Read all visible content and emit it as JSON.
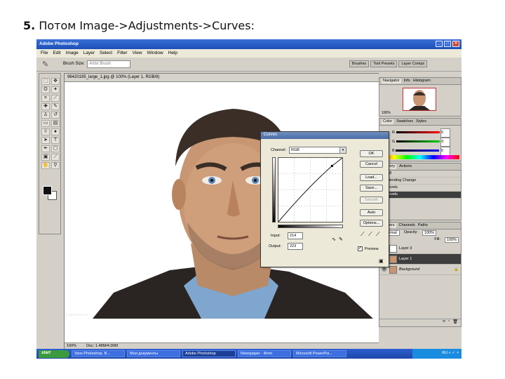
{
  "slide_heading": {
    "number": "5.",
    "text": "Потом Image->Adjustments->Curves:"
  },
  "app": {
    "title": "Adobe Photoshop",
    "menu": [
      "File",
      "Edit",
      "Image",
      "Layer",
      "Select",
      "Filter",
      "View",
      "Window",
      "Help"
    ],
    "options_bar": {
      "label": "Brush Size:",
      "field_placeholder": "Artist Brush",
      "well_tabs": [
        "Brushes",
        "Tool Presets",
        "Layer Comps"
      ]
    },
    "document": {
      "title": "96420195_large_1.jpg @ 100% (Layer 1, RGB/8)",
      "status_zoom": "100%",
      "status_doc": "Doc: 1.48M/4.00M",
      "watermark": "hughlaurie.net"
    },
    "curves_dialog": {
      "title": "Curves",
      "channel_label": "Channel:",
      "channel_value": "RGB",
      "buttons": [
        "OK",
        "Cancel",
        "Load...",
        "Save...",
        "Smooth",
        "Auto",
        "Options..."
      ],
      "disabled_buttons": [
        "Smooth"
      ],
      "input_label": "Input:",
      "input_value": "214",
      "output_label": "Output:",
      "output_value": "223",
      "preview_label": "Preview",
      "preview_checked": true,
      "curve_point": {
        "input": 214,
        "output": 223
      }
    },
    "panels": {
      "navigator_tabs": [
        "Navigator",
        "Info",
        "Histogram"
      ],
      "navigator_zoom": "100%",
      "color_tabs": [
        "Color",
        "Swatches",
        "Styles"
      ],
      "color_channels": [
        {
          "label": "R",
          "value": "0"
        },
        {
          "label": "G",
          "value": "0"
        },
        {
          "label": "B",
          "value": "0"
        }
      ],
      "history_tabs": [
        "History",
        "Actions"
      ],
      "history_items": [
        "Fill",
        "Blending Change",
        "Levels",
        "Levels"
      ],
      "history_selected": 3,
      "layers_tabs": [
        "Layers",
        "Channels",
        "Paths"
      ],
      "layers_mode": "Normal",
      "opacity_label": "Opacity:",
      "opacity_value": "100%",
      "fill_label": "Fill:",
      "fill_value": "100%",
      "layers": [
        "Layer 3",
        "Layer 1",
        "Background"
      ],
      "layers_selected": 1
    },
    "taskbar": {
      "start": "start",
      "items": [
        "Урок Photoshop. В...",
        "Мои документы",
        "Adobe Photoshop",
        "Newspaper - Фото",
        "Microsoft PowerPoi..."
      ],
      "clock": "RU  «  ✓  ⚬"
    }
  },
  "colors": {
    "titlebar": "#1c4fb8",
    "taskbar": "#1e47a8",
    "dialog_bg": "#ece9d8",
    "selected_row": "#3e3e3e"
  }
}
